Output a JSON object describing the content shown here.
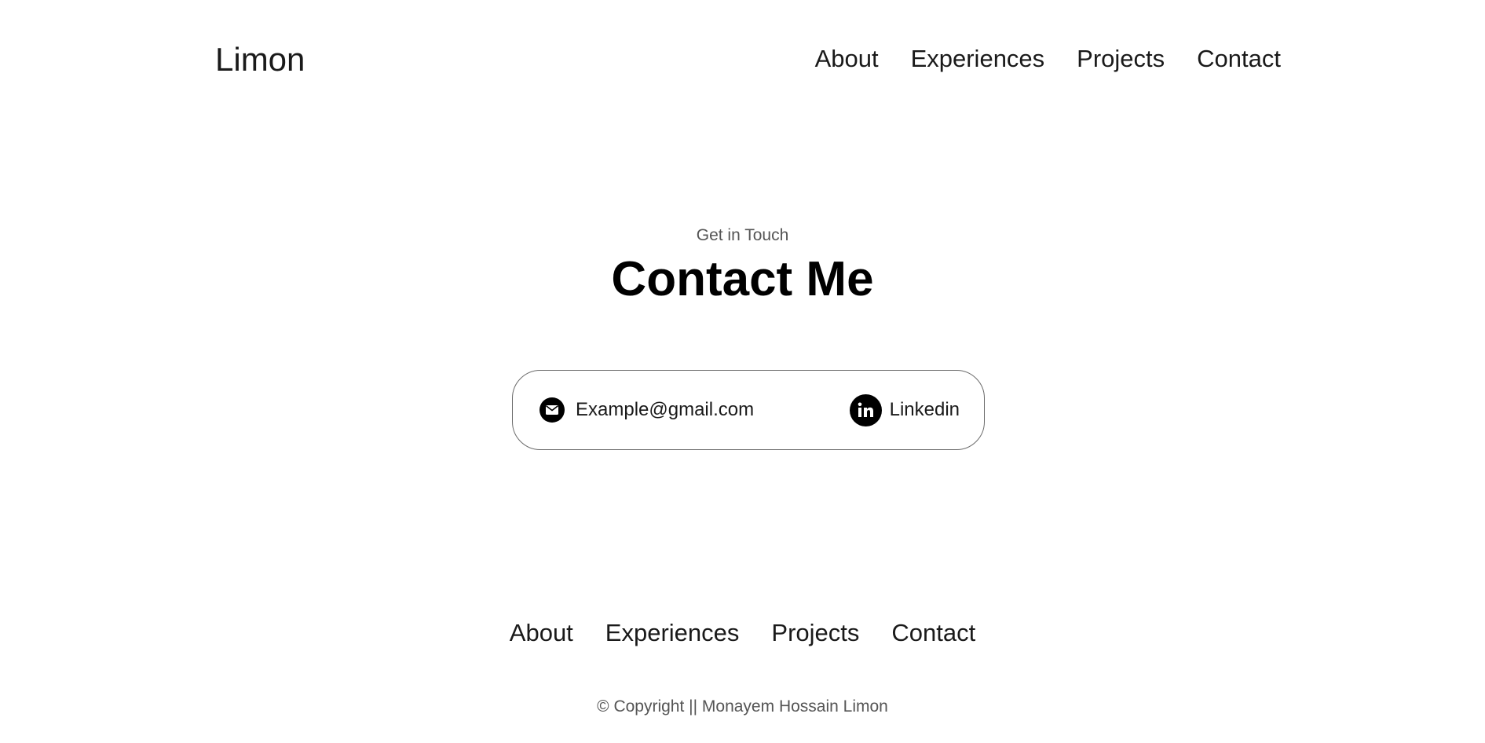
{
  "header": {
    "logo": "Limon",
    "nav": [
      "About",
      "Experiences",
      "Projects",
      "Contact"
    ]
  },
  "contact_section": {
    "subtitle": "Get in Touch",
    "title": "Contact Me",
    "email": {
      "icon": "email-icon",
      "text": "Example@gmail.com"
    },
    "linkedin": {
      "icon": "linkedin-icon",
      "text": "Linkedin"
    }
  },
  "footer": {
    "nav": [
      "About",
      "Experiences",
      "Projects",
      "Contact"
    ],
    "copyright": "© Copyright || Monayem Hossain Limon"
  }
}
